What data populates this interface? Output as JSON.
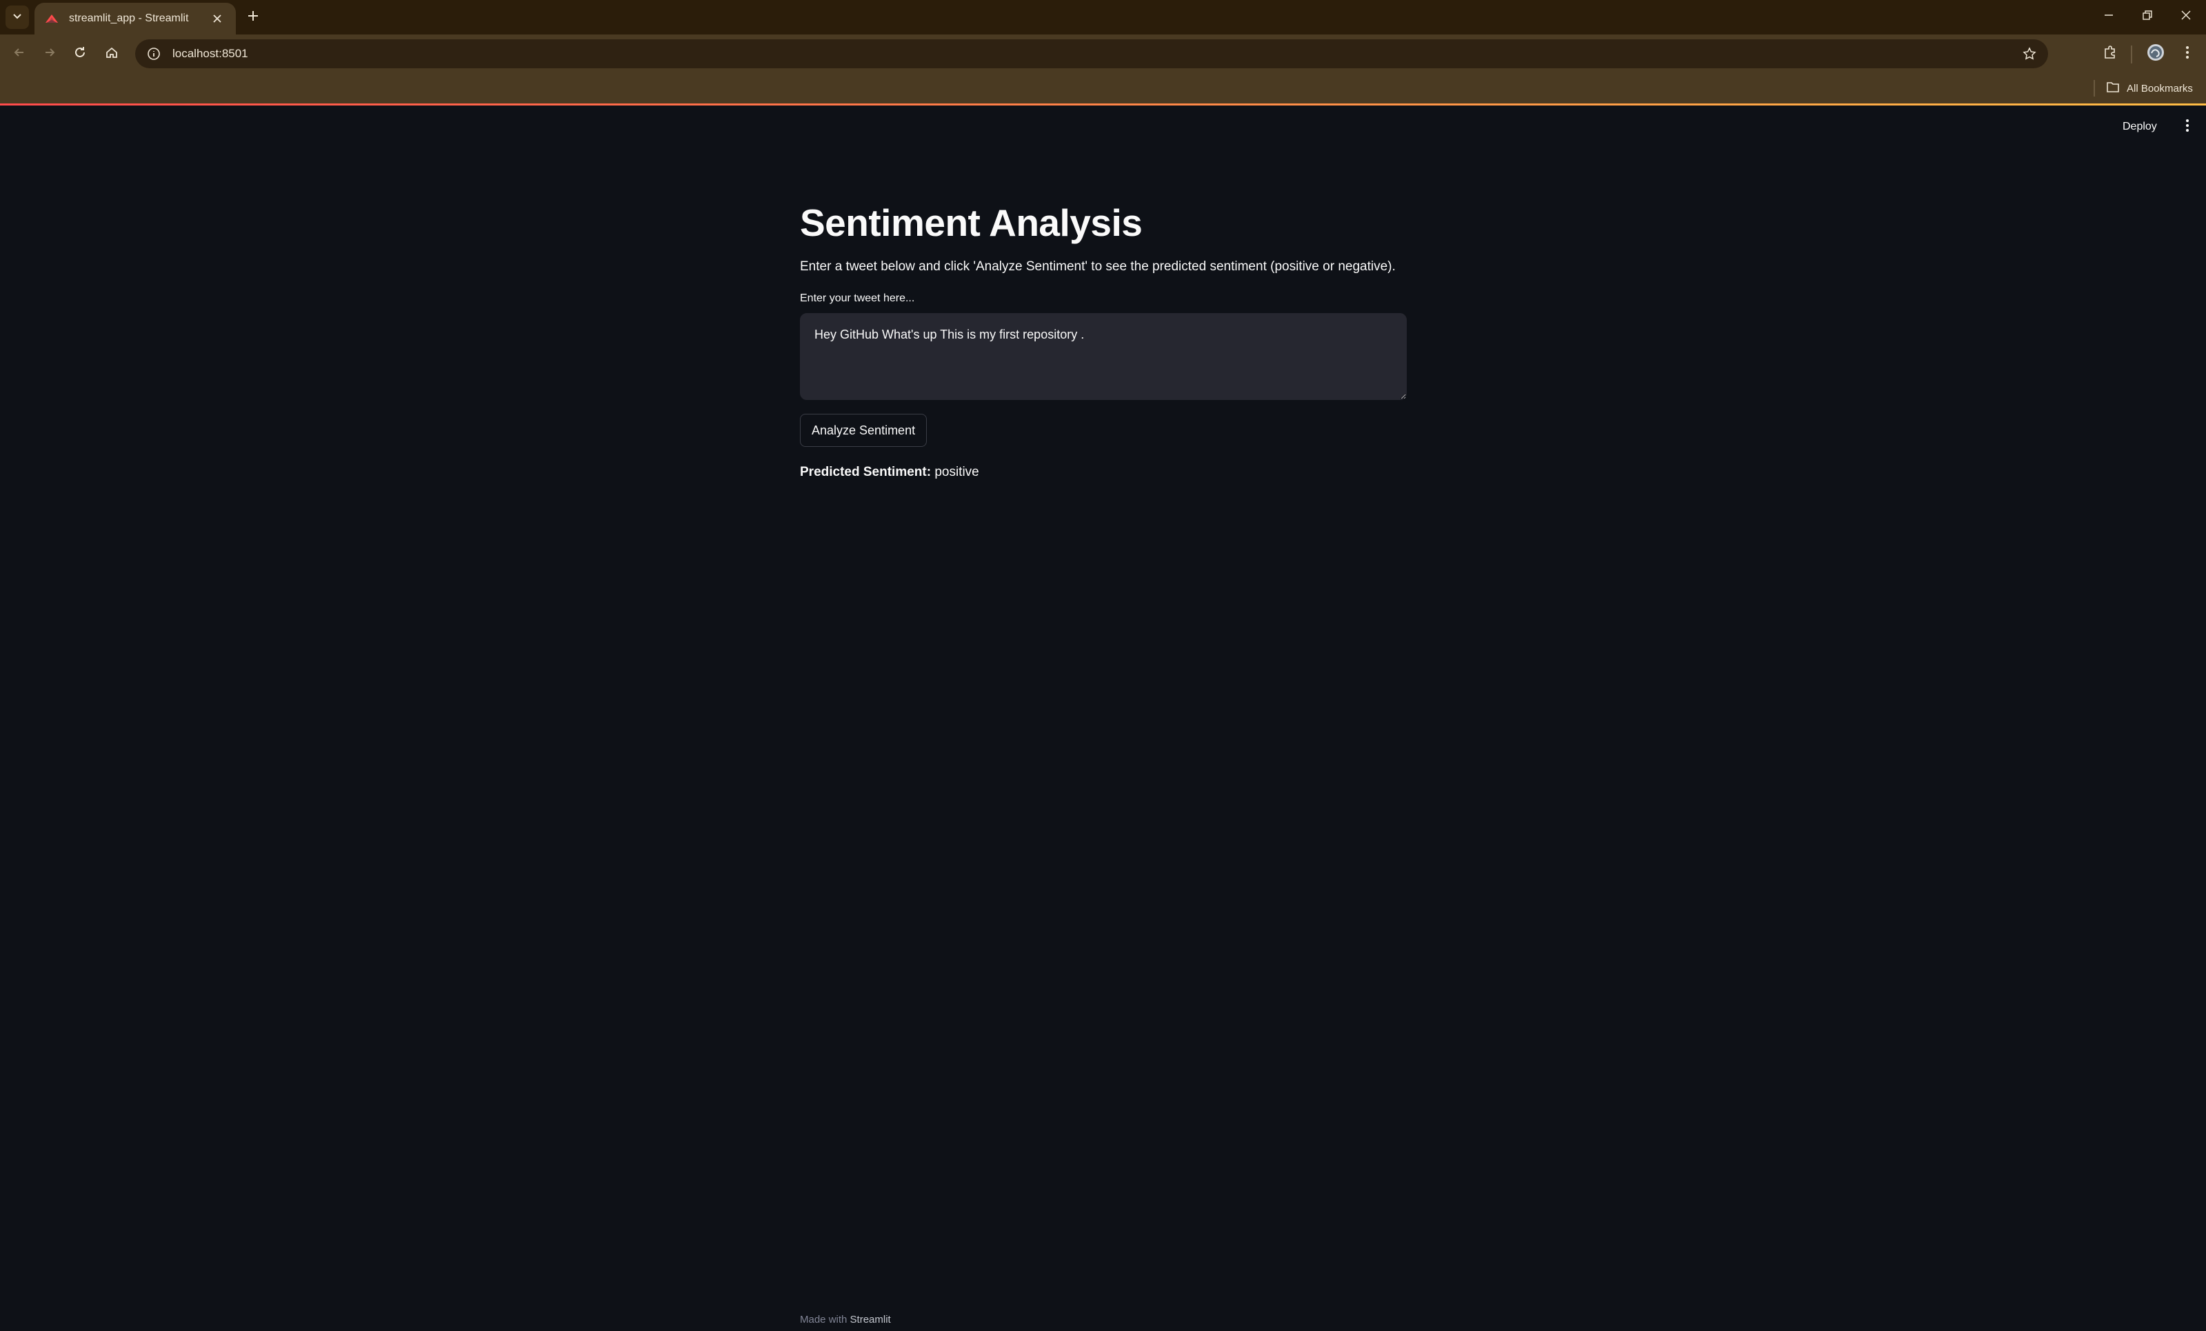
{
  "browser": {
    "tab_title": "streamlit_app - Streamlit",
    "url": "localhost:8501",
    "bookmarks_label": "All Bookmarks",
    "icons": [
      "tab-search-icon",
      "streamlit-favicon",
      "close-icon",
      "plus-icon",
      "minimize-icon",
      "restore-icon",
      "close-window-icon",
      "back-arrow-icon",
      "forward-arrow-icon",
      "reload-icon",
      "home-icon",
      "site-info-icon",
      "star-icon",
      "extensions-icon",
      "profile-avatar",
      "more-vert-icon",
      "folder-icon"
    ]
  },
  "app": {
    "deploy_label": "Deploy",
    "title": "Sentiment Analysis",
    "description": "Enter a tweet below and click 'Analyze Sentiment' to see the predicted sentiment (positive or negative).",
    "input_label": "Enter your tweet here...",
    "input_value": "Hey GitHub What's up This is my first repository .",
    "button_label": "Analyze Sentiment",
    "result_label": "Predicted Sentiment:",
    "result_value": "positive",
    "footer_prefix": "Made with",
    "footer_link": "Streamlit"
  },
  "colors": {
    "app_background": "#0e1117",
    "browser_chrome": "#4a3a22",
    "tabstrip": "#2b1d0a",
    "input_background": "#262730",
    "accent_red": "#ff4b4b",
    "accent_yellow": "#ffbd45"
  }
}
